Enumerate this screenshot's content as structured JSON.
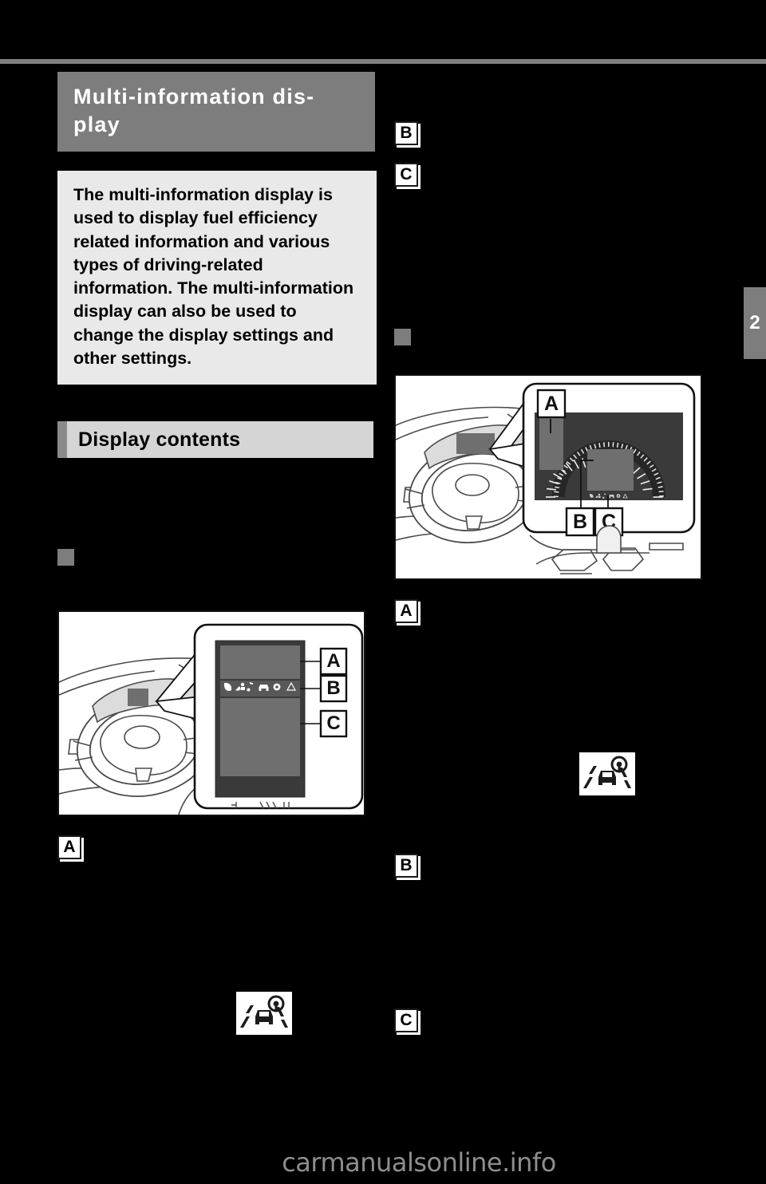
{
  "page": {
    "background_color": "#000000",
    "chapter_tab": "2",
    "footer_watermark": "carmanualsonline.info",
    "accent_gray": "#7d7d7d",
    "panel_gray": "#d5d5d5",
    "callout_gray": "#e9e9e9"
  },
  "left_column": {
    "section_title": "Multi-information dis-play",
    "intro_text": "The multi-information display is used to display fuel efficiency related information and various types of driving-related information. The multi-information display can also be used to change the display settings and other settings.",
    "subheading": "Display contents",
    "badges": {
      "a": "A",
      "b": "B",
      "c": "C"
    },
    "figure": {
      "caption": "",
      "labels": [
        "A",
        "B",
        "C"
      ],
      "status_icons": [
        "leaf-icon",
        "navigation-icon",
        "music-note-icon",
        "vehicle-icon",
        "gear-icon",
        "warning-triangle-icon"
      ]
    },
    "inline_icon": "lane-departure-alert-icon"
  },
  "right_column": {
    "badges": {
      "b": "B",
      "c": "C",
      "a": "A",
      "b2": "B",
      "c2": "C"
    },
    "figure": {
      "caption": "",
      "labels": [
        "A",
        "B",
        "C"
      ],
      "status_icons": [
        "leaf-icon",
        "navigation-icon",
        "music-note-icon",
        "vehicle-icon",
        "gear-icon",
        "warning-triangle-icon"
      ]
    },
    "inline_icon": "lane-departure-alert-icon"
  }
}
